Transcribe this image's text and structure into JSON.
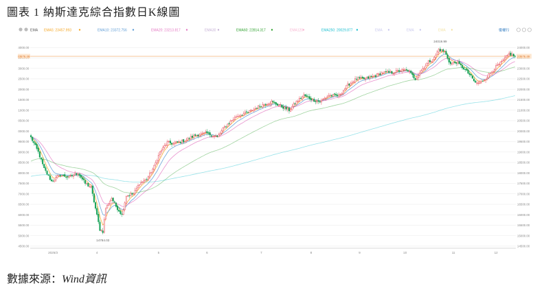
{
  "figure": {
    "title": "圖表 1 納斯達克綜合指數日K線圖"
  },
  "source": {
    "label": "數據來源：",
    "value": "Wind資訊"
  },
  "toolbar": {
    "indicator": "EMA",
    "items": [
      {
        "label": "EMA5",
        "value": "23457.993",
        "color": "#f5a623"
      },
      {
        "label": "EMA10",
        "value": "23372.756",
        "color": "#5b9bd5"
      },
      {
        "label": "EMA20",
        "value": "23213.817",
        "color": "#e377c2"
      },
      {
        "label": "EMA30",
        "value": "",
        "color": "#c5b0d5"
      },
      {
        "label": "EMA60",
        "value": "22814.317",
        "color": "#2ca02c"
      },
      {
        "label": "EMA120",
        "value": "",
        "color": "#f7b6d2"
      },
      {
        "label": "EMA250",
        "value": "20029.877",
        "color": "#17becf"
      },
      {
        "label": "EMA",
        "value": "",
        "color": "#c9c9ee"
      },
      {
        "label": "EMA",
        "value": "",
        "color": "#c9c9ee"
      },
      {
        "label": "EMA",
        "value": "",
        "color": "#f3e3a6"
      }
    ],
    "reset_label": "復權行",
    "colors": {
      "up": "#e8505b",
      "down": "#1aa35a",
      "price_line": "#f0a35c",
      "grid": "#eeeeee"
    }
  },
  "chart_data": {
    "type": "candlestick",
    "ylim": [
      14400,
      24300
    ],
    "yticks": [
      14500,
      15000,
      15500,
      16000,
      16500,
      17000,
      17500,
      18000,
      18500,
      19000,
      19500,
      20000,
      20500,
      21000,
      21500,
      22000,
      22500,
      23000,
      23500,
      24000
    ],
    "ytick_labels_right": [
      "14500.00",
      "15000.00",
      "15500.00",
      "16000.00",
      "16500.00",
      "17000.00",
      "17500.00",
      "18000.00",
      "18500.00",
      "19000.00",
      "19500.00",
      "20000.00",
      "20500.00",
      "21000.00",
      "21500.00",
      "22000.00",
      "22500.00",
      "23000.00",
      "23500.00",
      "24000.00"
    ],
    "ytick_labels_left": [
      "14500.00",
      "15000.00",
      "15500.00",
      "16000.00",
      "16500.00",
      "17000.00",
      "17500.00",
      "18000.00",
      "18500.00",
      "19000.00",
      "19500.00",
      "20000.00",
      "20500.00",
      "21000.00",
      "21500.00",
      "22000.00",
      "22500.00",
      "23000.00",
      "23500.00",
      "24000.00"
    ],
    "last_price": 23576.49,
    "last_price_label": "23576.49",
    "xticks": [
      {
        "index": 15,
        "label": "2025/3"
      },
      {
        "index": 45,
        "label": "4"
      },
      {
        "index": 87,
        "label": "5"
      },
      {
        "index": 120,
        "label": "6"
      },
      {
        "index": 157,
        "label": "7"
      },
      {
        "index": 191,
        "label": "8"
      },
      {
        "index": 224,
        "label": "9"
      },
      {
        "index": 255,
        "label": "10"
      },
      {
        "index": 288,
        "label": "11"
      },
      {
        "index": 317,
        "label": "12"
      }
    ],
    "annotations": [
      {
        "index": 49,
        "label": "14784.03"
      },
      {
        "index": 279,
        "label": "24019.99"
      }
    ],
    "anchors": [
      [
        0,
        19700
      ],
      [
        5,
        19000
      ],
      [
        9,
        18200
      ],
      [
        14,
        17600
      ],
      [
        20,
        17900
      ],
      [
        26,
        17800
      ],
      [
        32,
        18000
      ],
      [
        37,
        17500
      ],
      [
        41,
        17300
      ],
      [
        44,
        16300
      ],
      [
        47,
        15300
      ],
      [
        49,
        15200
      ],
      [
        51,
        16300
      ],
      [
        55,
        16800
      ],
      [
        58,
        16400
      ],
      [
        62,
        16000
      ],
      [
        65,
        16900
      ],
      [
        70,
        17000
      ],
      [
        74,
        17500
      ],
      [
        79,
        17700
      ],
      [
        84,
        18300
      ],
      [
        88,
        19000
      ],
      [
        93,
        19450
      ],
      [
        97,
        19400
      ],
      [
        105,
        19550
      ],
      [
        112,
        19800
      ],
      [
        120,
        19900
      ],
      [
        127,
        19700
      ],
      [
        132,
        20200
      ],
      [
        140,
        20700
      ],
      [
        148,
        20900
      ],
      [
        156,
        21200
      ],
      [
        164,
        21400
      ],
      [
        170,
        21200
      ],
      [
        176,
        21000
      ],
      [
        181,
        21400
      ],
      [
        186,
        21700
      ],
      [
        192,
        21500
      ],
      [
        197,
        21400
      ],
      [
        203,
        21700
      ],
      [
        210,
        21700
      ],
      [
        216,
        22200
      ],
      [
        222,
        22500
      ],
      [
        228,
        22500
      ],
      [
        233,
        22600
      ],
      [
        240,
        22800
      ],
      [
        247,
        22800
      ],
      [
        252,
        22900
      ],
      [
        257,
        22900
      ],
      [
        262,
        22500
      ],
      [
        266,
        22900
      ],
      [
        271,
        23300
      ],
      [
        275,
        23500
      ],
      [
        278,
        23900
      ],
      [
        282,
        23800
      ],
      [
        286,
        23200
      ],
      [
        290,
        23300
      ],
      [
        295,
        23000
      ],
      [
        299,
        22700
      ],
      [
        303,
        22300
      ],
      [
        306,
        22300
      ],
      [
        311,
        22600
      ],
      [
        316,
        23000
      ],
      [
        321,
        23300
      ],
      [
        326,
        23700
      ],
      [
        330,
        23576
      ]
    ],
    "overlays": [
      {
        "name": "EMA5",
        "color": "#f5a623",
        "period": 5,
        "init_offset": 0,
        "opacity": 0.9
      },
      {
        "name": "EMA10",
        "color": "#5b9bd5",
        "period": 10,
        "init_offset": 0,
        "opacity": 0.9
      },
      {
        "name": "EMA20",
        "color": "#e377c2",
        "period": 20,
        "init_offset": 0,
        "opacity": 0.8
      },
      {
        "name": "EMA60",
        "color": "#2ca02c",
        "period": 60,
        "init_offset": -1200,
        "opacity": 0.45
      },
      {
        "name": "EMA250",
        "color": "#17becf",
        "period": 250,
        "init_offset": -1900,
        "opacity": 0.45
      }
    ]
  }
}
